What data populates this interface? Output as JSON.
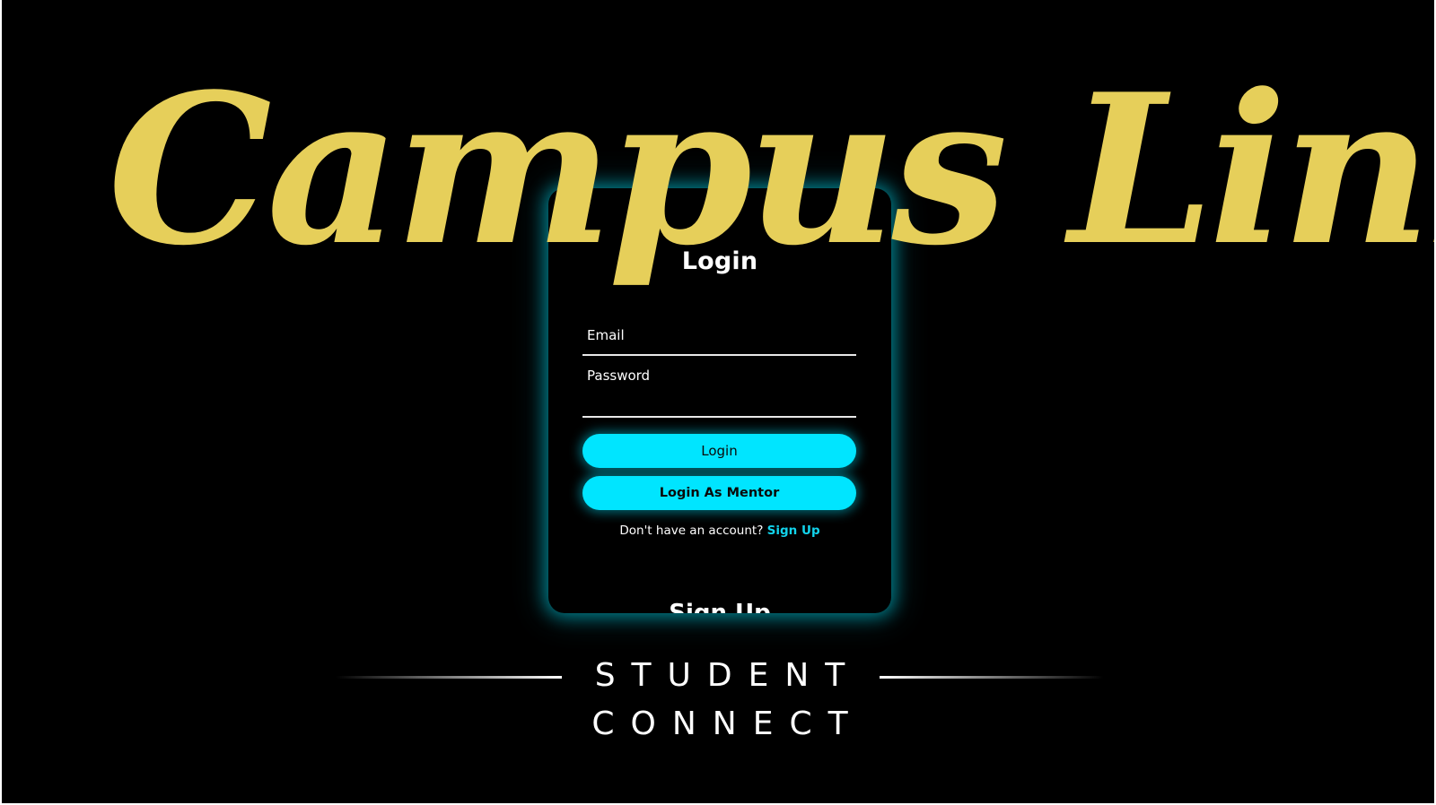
{
  "brand": {
    "script_title": "Campus Link",
    "tagline_line1": "STUDENT",
    "tagline_line2": "CONNECT",
    "accent_color": "#e6cf5a"
  },
  "login_card": {
    "title": "Login",
    "email_label": "Email",
    "password_label": "Password",
    "login_button": "Login",
    "mentor_button": "Login As Mentor",
    "no_account_text": "Don't have an account?",
    "signup_link": "Sign Up",
    "next_panel_title": "Sign Up",
    "accent_color": "#00e5ff"
  }
}
